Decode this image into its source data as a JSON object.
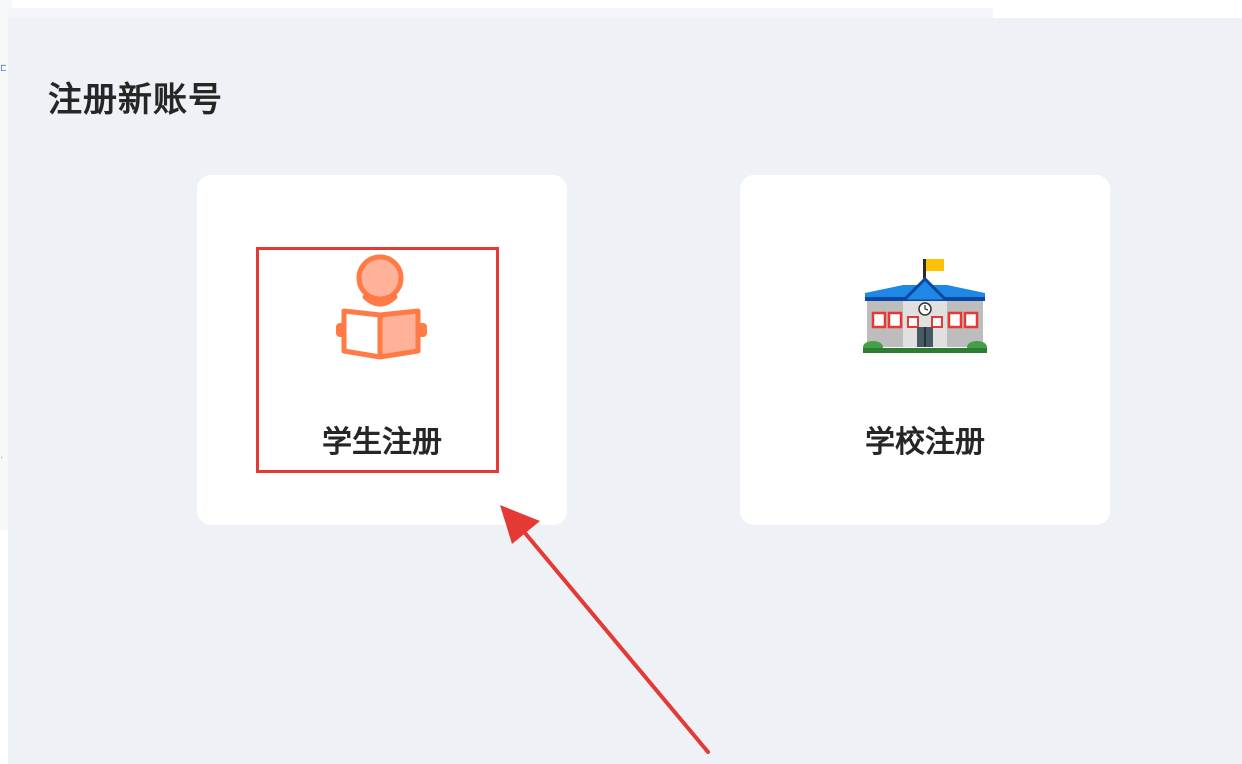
{
  "page": {
    "title": "注册新账号"
  },
  "cards": [
    {
      "label": "学生注册",
      "icon": "student-reading-icon",
      "highlighted": true
    },
    {
      "label": "学校注册",
      "icon": "school-building-icon",
      "highlighted": false
    }
  ],
  "colors": {
    "background": "#eef1f5",
    "card": "#ffffff",
    "student_icon": "#ff7a45",
    "highlight": "#e53935"
  }
}
